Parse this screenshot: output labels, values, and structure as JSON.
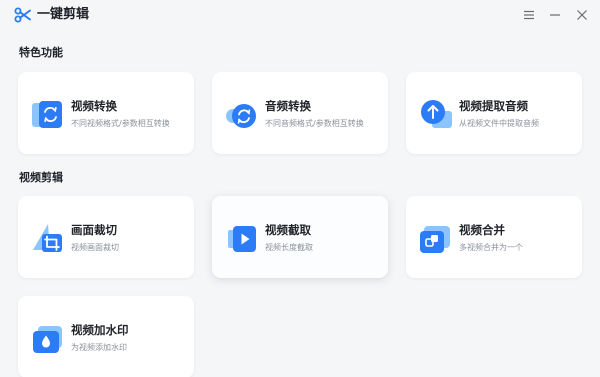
{
  "app": {
    "title": "一键剪辑"
  },
  "sections": [
    {
      "title": "特色功能"
    },
    {
      "title": "视频剪辑"
    }
  ],
  "cards": [
    {
      "title": "视频转换",
      "desc": "不同视频格式/参数相互转换",
      "icon": "video-convert-icon"
    },
    {
      "title": "音频转换",
      "desc": "不同音频格式/参数相互转换",
      "icon": "audio-convert-icon"
    },
    {
      "title": "视频提取音频",
      "desc": "从视频文件中提取音频",
      "icon": "extract-audio-icon"
    },
    {
      "title": "画面裁切",
      "desc": "视频画面裁切",
      "icon": "crop-icon"
    },
    {
      "title": "视频截取",
      "desc": "视频长度截取",
      "icon": "video-trim-icon"
    },
    {
      "title": "视频合并",
      "desc": "多视频合并为一个",
      "icon": "video-merge-icon"
    },
    {
      "title": "视频加水印",
      "desc": "为视频添加水印",
      "icon": "watermark-icon"
    }
  ],
  "colors": {
    "accent": "#2b7cf6",
    "accent_light": "#8cc4ff",
    "background": "#f5f6f8",
    "card": "#ffffff"
  }
}
